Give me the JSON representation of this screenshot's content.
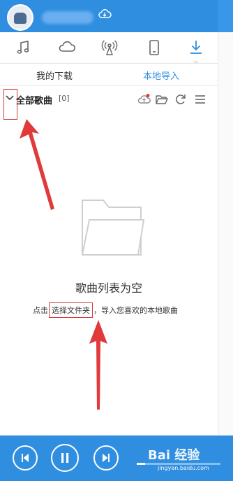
{
  "header": {
    "avatar_icon": "user-avatar-icon",
    "cloud_icon": "cloud-sync-icon"
  },
  "tabs": [
    {
      "icon": "music-note-icon"
    },
    {
      "icon": "cloud-icon"
    },
    {
      "icon": "radio-icon"
    },
    {
      "icon": "device-icon"
    },
    {
      "icon": "download-icon",
      "active": true
    }
  ],
  "subtabs": {
    "my_downloads": "我的下载",
    "local_import": "本地导入"
  },
  "list": {
    "title": "全部歌曲",
    "count": "[0]"
  },
  "empty": {
    "title": "歌曲列表为空",
    "hint_before": "点击",
    "hint_link": "选择文件夹",
    "hint_after": "，导入您喜欢的本地歌曲"
  },
  "player": {
    "progress": 0.1
  },
  "watermark": {
    "brand": "Bai 经验",
    "url": "jingyan.baidu.com"
  },
  "colors": {
    "accent": "#2f8ee0",
    "annotation": "#e03a3a"
  }
}
